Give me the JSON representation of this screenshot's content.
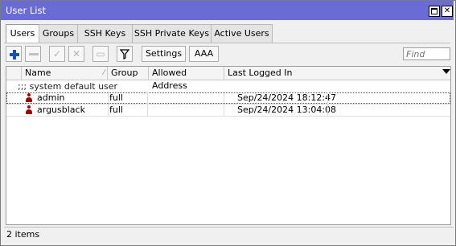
{
  "window": {
    "title": "User List",
    "buttons": {
      "maximize": "",
      "close": "✕"
    }
  },
  "tabs": [
    {
      "label": "Users",
      "active": true
    },
    {
      "label": "Groups",
      "active": false
    },
    {
      "label": "SSH Keys",
      "active": false
    },
    {
      "label": "SSH Private Keys",
      "active": false
    },
    {
      "label": "Active Users",
      "active": false
    }
  ],
  "toolbar": {
    "add_icon": "plus-icon",
    "remove_icon": "minus-icon",
    "enable_icon": "check-icon",
    "disable_icon": "cross-icon",
    "comment_icon": "comment-icon",
    "filter_icon": "filter-icon",
    "settings_label": "Settings",
    "aaa_label": "AAA",
    "find_placeholder": "Find"
  },
  "table": {
    "columns": [
      "Name",
      "Group",
      "Allowed Address",
      "Last Logged In"
    ],
    "section_label": ";;; system default user",
    "rows": [
      {
        "name": "admin",
        "group": "full",
        "allowed_address": "",
        "last_logged_in": "Sep/24/2024 18:12:47"
      },
      {
        "name": "argusblack",
        "group": "full",
        "allowed_address": "",
        "last_logged_in": "Sep/24/2024 13:04:08"
      }
    ]
  },
  "status": {
    "items": "2 items"
  }
}
